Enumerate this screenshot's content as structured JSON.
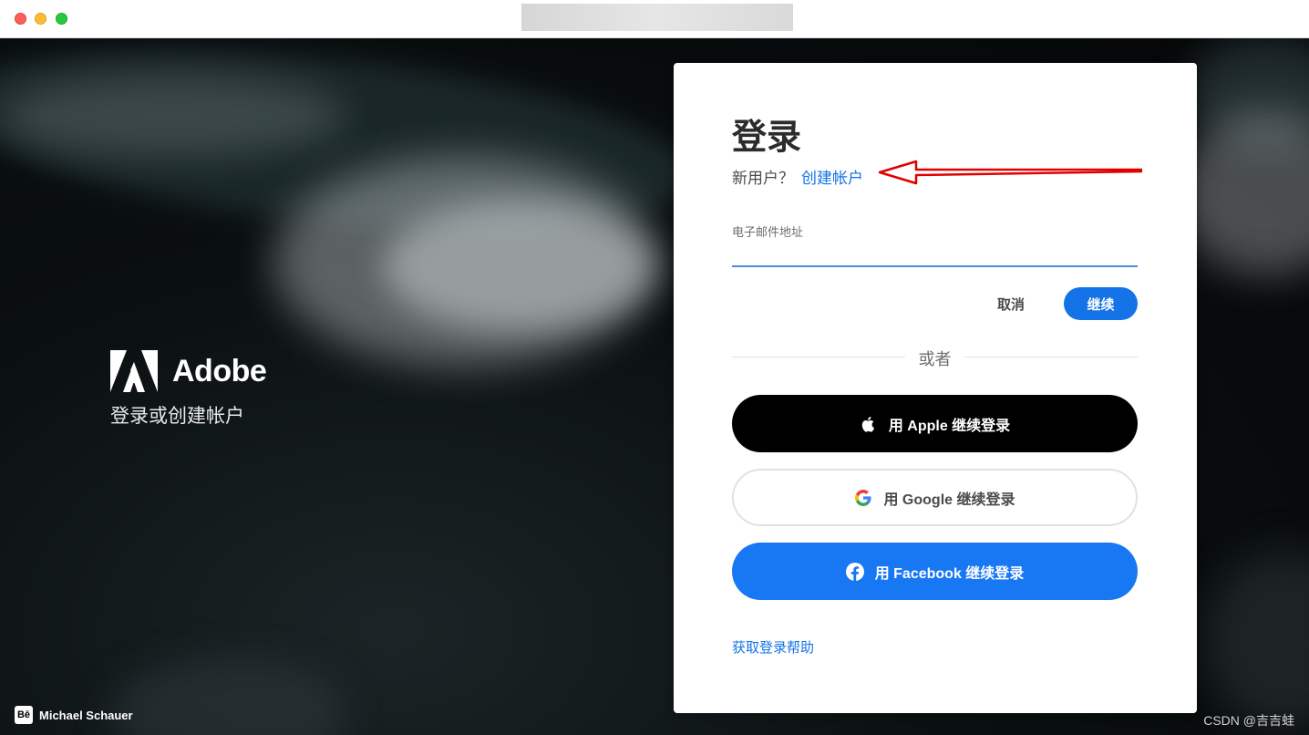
{
  "window": {
    "title_blurred": true
  },
  "brand": {
    "name": "Adobe",
    "tagline": "登录或创建帐户"
  },
  "credit": {
    "icon": "Bē",
    "name": "Michael Schauer"
  },
  "watermark": "CSDN @吉吉蛙",
  "login": {
    "title": "登录",
    "new_user_prompt": "新用户？",
    "create_account_link": "创建帐户",
    "email_label": "电子邮件地址",
    "email_value": "",
    "cancel_label": "取消",
    "continue_label": "继续",
    "divider_text": "或者",
    "apple_label": "用 Apple 继续登录",
    "google_label": "用 Google 继续登录",
    "facebook_label": "用 Facebook 继续登录",
    "help_link": "获取登录帮助"
  },
  "colors": {
    "accent": "#1473e6",
    "facebook": "#1877f2",
    "annotation_arrow": "#e00000"
  }
}
